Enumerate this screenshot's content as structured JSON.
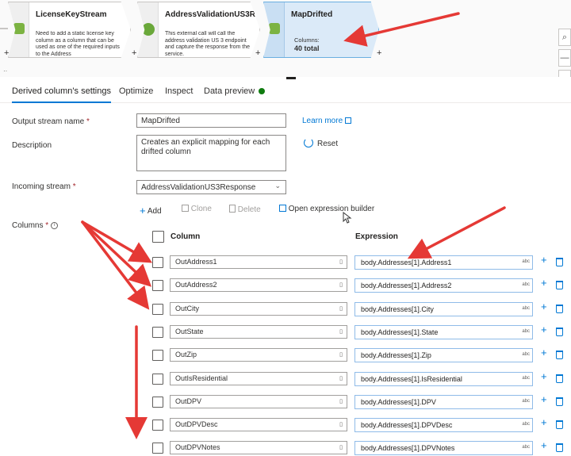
{
  "pipeline": {
    "nodes": [
      {
        "title": "LicenseKeyStream",
        "description": "Need to add a static license key column as a column that can be used as one of the required inputs to the Address"
      },
      {
        "title": "AddressValidationUS3R...",
        "description": "This external call will call the address validation US 3 endpoint and capture the response from the service."
      },
      {
        "title": "MapDrifted",
        "columns_label": "Columns:",
        "columns_value": "40 total"
      }
    ],
    "plus": "+",
    "zoom": [
      "⌕",
      "—"
    ]
  },
  "tabs": [
    {
      "label": "Derived column's settings"
    },
    {
      "label": "Optimize"
    },
    {
      "label": "Inspect"
    },
    {
      "label": "Data preview"
    }
  ],
  "form": {
    "output_stream_label": "Output stream name",
    "output_stream_value": "MapDrifted",
    "learn_more": "Learn more",
    "description_label": "Description",
    "description_value": "Creates an explicit mapping for each drifted column",
    "reset": "Reset",
    "incoming_stream_label": "Incoming stream",
    "incoming_stream_value": "AddressValidationUS3Response",
    "columns_label": "Columns",
    "required_mark": "*"
  },
  "toolbar": {
    "add": "Add",
    "clone": "Clone",
    "delete": "Delete",
    "open_expression_builder": "Open expression builder"
  },
  "table": {
    "column_header": "Column",
    "expression_header": "Expression",
    "rows": [
      {
        "column": "OutAddress1",
        "expression": "body.Addresses[1].Address1"
      },
      {
        "column": "OutAddress2",
        "expression": "body.Addresses[1].Address2"
      },
      {
        "column": "OutCity",
        "expression": "body.Addresses[1].City"
      },
      {
        "column": "OutState",
        "expression": "body.Addresses[1].State"
      },
      {
        "column": "OutZip",
        "expression": "body.Addresses[1].Zip"
      },
      {
        "column": "OutIsResidential",
        "expression": "body.Addresses[1].IsResidential"
      },
      {
        "column": "OutDPV",
        "expression": "body.Addresses[1].DPV"
      },
      {
        "column": "OutDPVDesc",
        "expression": "body.Addresses[1].DPVDesc"
      },
      {
        "column": "OutDPVNotes",
        "expression": "body.Addresses[1].DPVNotes"
      }
    ],
    "expr_suffix": "abc",
    "column_suffix": "▯"
  },
  "colors": {
    "accent": "#0078d4",
    "annotation": "#e53935",
    "selected_node": "#dbeaf8",
    "status_green": "#107c10"
  }
}
